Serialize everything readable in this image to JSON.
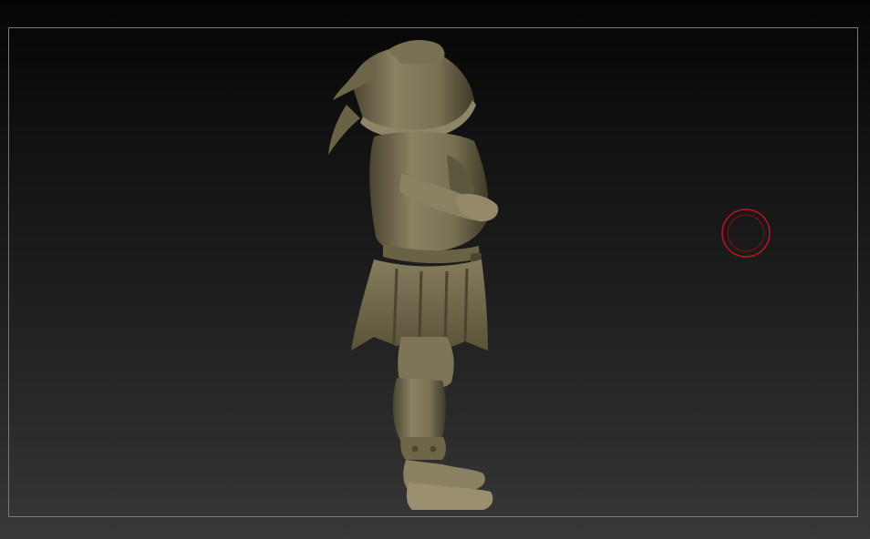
{
  "viewport": {
    "background_top": "#050505",
    "background_bottom": "#383838",
    "frame_color": "#7a7a7a"
  },
  "model": {
    "material_color": "#7e7558",
    "shadow_color": "#3c3726",
    "highlight_color": "#a69c77"
  },
  "brush_cursor": {
    "icon": "brush-circle-icon",
    "color": "#c0141b"
  }
}
